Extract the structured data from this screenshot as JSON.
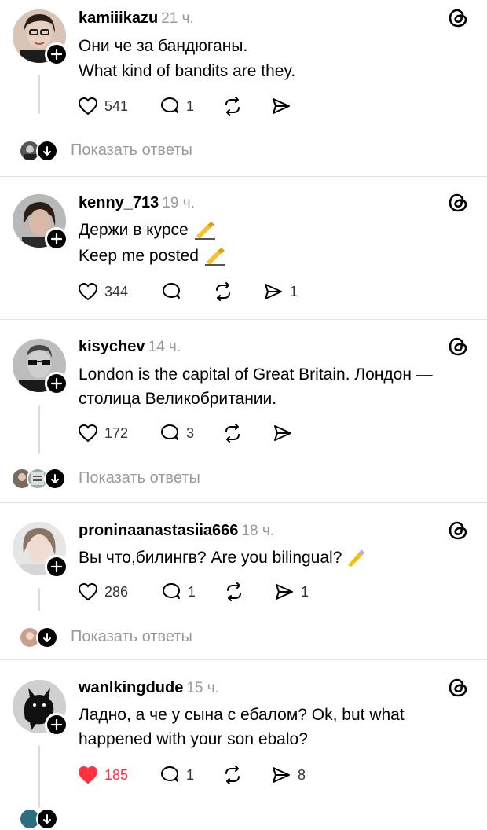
{
  "show_replies_label": "Показать ответы",
  "colors": {
    "like_active": "#ff3040",
    "muted": "#9a9a9a",
    "separator": "#e3e3e3"
  },
  "posts": [
    {
      "username": "kamiiikazu",
      "time": "21 ч.",
      "lines": [
        "Они че за бандюганы.",
        "What kind of bandits are they."
      ],
      "likes": "541",
      "replies": "1",
      "reposts": "",
      "shares": "",
      "liked": false,
      "has_show_replies": true
    },
    {
      "username": "kenny_713",
      "time": "19 ч.",
      "lines": [
        "Держи в курсе",
        "Keep me posted"
      ],
      "likes": "344",
      "replies": "",
      "reposts": "",
      "shares": "1",
      "liked": false,
      "has_show_replies": false
    },
    {
      "username": "kisychev",
      "time": "14 ч.",
      "lines": [
        "London is the capital of Great Britain. Лондон —",
        "столица Великобритании."
      ],
      "likes": "172",
      "replies": "3",
      "reposts": "",
      "shares": "",
      "liked": false,
      "has_show_replies": true
    },
    {
      "username": "proninaanastasiia666",
      "time": "18 ч.",
      "lines": [
        "Вы что,билингв? Are you bilingual?"
      ],
      "likes": "286",
      "replies": "1",
      "reposts": "",
      "shares": "1",
      "liked": false,
      "has_show_replies": true
    },
    {
      "username": "wanlkingdude",
      "time": "15 ч.",
      "lines": [
        "Ладно, а че у сына с ебалом? Ok, but what",
        "happened with your son ebalo?"
      ],
      "likes": "185",
      "replies": "1",
      "reposts": "",
      "shares": "8",
      "liked": true,
      "has_show_replies": true
    }
  ]
}
